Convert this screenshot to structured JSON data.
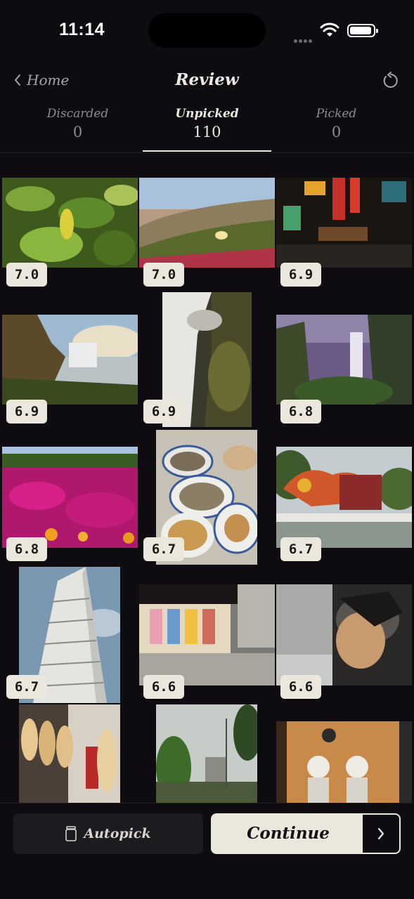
{
  "status": {
    "time": "11:14"
  },
  "nav": {
    "back_label": "Home",
    "title": "Review"
  },
  "tabs": [
    {
      "label": "Discarded",
      "count": "0"
    },
    {
      "label": "Unpicked",
      "count": "110"
    },
    {
      "label": "Picked",
      "count": "0"
    }
  ],
  "active_tab": "Unpicked",
  "photos": [
    {
      "subject": "green leaves",
      "score": "7.0"
    },
    {
      "subject": "beach grass with flower",
      "score": "7.0"
    },
    {
      "subject": "neon street at night",
      "score": "6.9"
    },
    {
      "subject": "waterfall in canyon",
      "score": "6.9"
    },
    {
      "subject": "long exposure waterfall",
      "score": "6.9"
    },
    {
      "subject": "misty waterfall",
      "score": "6.8"
    },
    {
      "subject": "pink flower field",
      "score": "6.8"
    },
    {
      "subject": "table of dishes",
      "score": "6.7"
    },
    {
      "subject": "dragon sculpture",
      "score": "6.7"
    },
    {
      "subject": "tall white building",
      "score": "6.7"
    },
    {
      "subject": "anime shop street",
      "score": "6.6"
    },
    {
      "subject": "mural wall",
      "score": "6.6"
    },
    {
      "subject": "wig shop"
    },
    {
      "subject": "street with trees"
    },
    {
      "subject": "astronaut figures"
    }
  ],
  "bottom": {
    "autopick_label": "Autopick",
    "continue_label": "Continue"
  },
  "colors": {
    "background": "#0e0c11",
    "accent": "#ece7dd",
    "muted_text": "#8f8b91"
  }
}
